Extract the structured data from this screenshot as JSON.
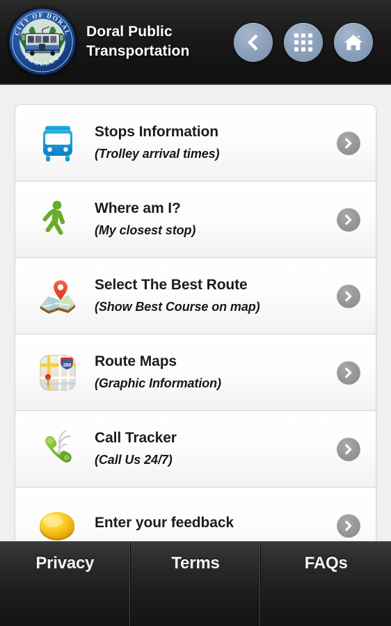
{
  "header": {
    "title": "Doral Public Transportation",
    "logo_alt": "City of Doral Trolley seal",
    "logo_text_top": "CITY OF DORAL",
    "logo_text_bottom": "TROLLEY",
    "nav": [
      {
        "name": "back-button",
        "icon": "chevron-left-icon",
        "label": "Back"
      },
      {
        "name": "apps-grid-button",
        "icon": "grid-icon",
        "label": "Menu"
      },
      {
        "name": "home-button",
        "icon": "home-icon",
        "label": "Home"
      }
    ]
  },
  "menu": {
    "items": [
      {
        "title": "Stops Information",
        "subtitle": "(Trolley arrival times)",
        "icon": "bus-icon",
        "icon_color": "#1b9fd8"
      },
      {
        "title": "Where am I?",
        "subtitle": "(My closest stop)",
        "icon": "pedestrian-icon",
        "icon_color": "#6aab29"
      },
      {
        "title": "Select The Best Route",
        "subtitle": "(Show Best Course on map)",
        "icon": "map-pin-icon",
        "icon_color": "#e8402a"
      },
      {
        "title": "Route Maps",
        "subtitle": "(Graphic Information)",
        "icon": "route-map-icon",
        "icon_color": "#d9d4c8"
      },
      {
        "title": "Call Tracker",
        "subtitle": "(Call Us 24/7)",
        "icon": "phone-call-icon",
        "icon_color": "#74b52e"
      },
      {
        "title": "Enter your feedback",
        "subtitle": "",
        "icon": "coin-icon",
        "icon_color": "#f5c518"
      }
    ]
  },
  "footer": {
    "tabs": [
      {
        "label": "Privacy",
        "name": "tab-privacy"
      },
      {
        "label": "Terms",
        "name": "tab-terms"
      },
      {
        "label": "FAQs",
        "name": "tab-faqs"
      }
    ]
  },
  "colors": {
    "header_bg": "#141414",
    "page_bg": "#f0f0f0",
    "row_bg": "#fdfdfd",
    "accent_blue": "#8ba0ba",
    "chevron_gray": "#969696",
    "footer_bg": "#1d1d1d"
  }
}
